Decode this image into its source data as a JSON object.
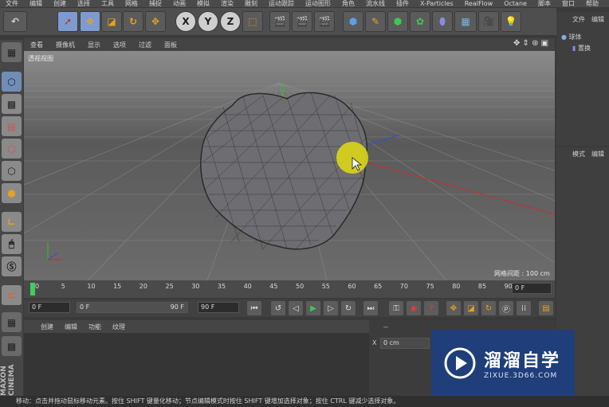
{
  "menubar": {
    "items": [
      "文件",
      "编辑",
      "创建",
      "选择",
      "工具",
      "网格",
      "捕捉",
      "动画",
      "模拟",
      "渲染",
      "雕刻",
      "运动跟踪",
      "运动图形",
      "角色",
      "流水线",
      "插件",
      "X-Particles",
      "RealFlow",
      "Octane",
      "脚本",
      "窗口",
      "帮助"
    ]
  },
  "toolbar": {
    "axis_x": "X",
    "axis_y": "Y",
    "axis_z": "Z"
  },
  "viewport": {
    "menu": [
      "查看",
      "摄像机",
      "显示",
      "选项",
      "过滤",
      "面板"
    ],
    "label": "透视视图",
    "grid_spacing": "网格间距 : 100 cm"
  },
  "object_manager": {
    "tabs": [
      "文件",
      "编辑"
    ],
    "objects": [
      "球体",
      "置换"
    ]
  },
  "attributes": {
    "tabs": [
      "模式",
      "编辑"
    ]
  },
  "timeline": {
    "ticks": [
      "0",
      "5",
      "10",
      "15",
      "20",
      "25",
      "30",
      "35",
      "40",
      "45",
      "50",
      "55",
      "60",
      "65",
      "70",
      "75",
      "80",
      "85",
      "90"
    ],
    "end_field": "0 F"
  },
  "transport": {
    "current": "0 F",
    "range_start": "0 F",
    "range_end": "90 F",
    "max": "90 F"
  },
  "material": {
    "menu": [
      "创建",
      "编辑",
      "功能",
      "纹理"
    ]
  },
  "coordinates": {
    "x_label": "X",
    "x_value": "0 cm",
    "dash": "--"
  },
  "status": {
    "text": "移动：点击并拖动鼠标移动元素。按住 SHIFT 键量化移动；节点编辑模式时按住 SHIFT 键增加选择对象；按住 CTRL 键减少选择对象。"
  },
  "watermark": {
    "title": "溜溜自学",
    "url": "ZIXUE.3D66.COM"
  },
  "brand": {
    "vertical": "MAXON CINEMA"
  },
  "colors": {
    "cursor_highlight": "#d8d21a",
    "timeline_marker": "#3fd05a",
    "axis_green": "#28c428",
    "axis_red": "#c43030",
    "axis_blue": "#3050d0",
    "watermark_bg": "#1f3e7a"
  }
}
